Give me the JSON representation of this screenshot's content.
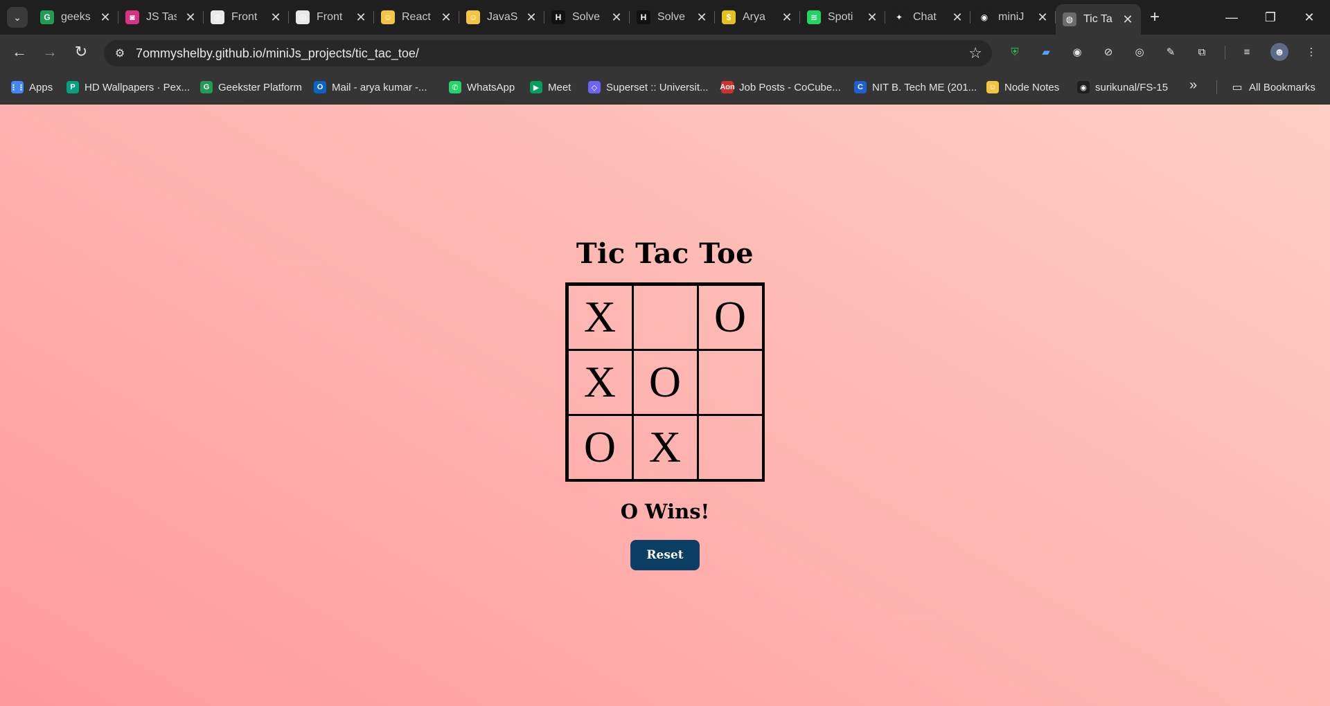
{
  "browser": {
    "tabs": [
      {
        "label": "geeks",
        "icon": "geekster-icon",
        "color": "#1f9d55",
        "glyph": "G"
      },
      {
        "label": "JS Tas",
        "icon": "task-app-icon",
        "color": "#d63384",
        "glyph": "◙"
      },
      {
        "label": "Front",
        "icon": "doc-icon",
        "color": "#e9e9e9",
        "glyph": "◎"
      },
      {
        "label": "Front",
        "icon": "doc-icon",
        "color": "#e9e9e9",
        "glyph": "◎"
      },
      {
        "label": "React",
        "icon": "smiley-icon",
        "color": "#f4c542",
        "glyph": "☺"
      },
      {
        "label": "JavaS",
        "icon": "smiley-icon",
        "color": "#f4c542",
        "glyph": "☺"
      },
      {
        "label": "Solve",
        "icon": "hackerrank-icon",
        "color": "#111111",
        "glyph": "H"
      },
      {
        "label": "Solve",
        "icon": "hackerrank-icon",
        "color": "#111111",
        "glyph": "H"
      },
      {
        "label": "Arya",
        "icon": "coin-icon",
        "color": "#e7c11a",
        "glyph": "$"
      },
      {
        "label": "Spoti",
        "icon": "spotify-icon",
        "color": "#1ed760",
        "glyph": "≋"
      },
      {
        "label": "Chat",
        "icon": "chatgpt-icon",
        "color": "#1f1f1f",
        "glyph": "✦"
      },
      {
        "label": "miniJ",
        "icon": "github-icon",
        "color": "#1f1f1f",
        "glyph": "◉"
      },
      {
        "label": "Tic Ta",
        "icon": "globe-icon",
        "color": "#6b6b6b",
        "glyph": "◍"
      }
    ],
    "new_tab": "+",
    "controls": {
      "minimize": "—",
      "restore": "❐",
      "close": "✕"
    },
    "url": "7ommyshelby.github.io/miniJs_projects/tic_tac_toe/",
    "bookmarks": [
      {
        "label": "Apps",
        "icon": "apps-grid-icon",
        "color": "#4285f4",
        "glyph": "⋮⋮"
      },
      {
        "label": "HD Wallpapers · Pex...",
        "icon": "pexels-icon",
        "color": "#05a081",
        "glyph": "P"
      },
      {
        "label": "Geekster Platform",
        "icon": "geekster-icon",
        "color": "#1f9d55",
        "glyph": "G"
      },
      {
        "label": "Mail - arya kumar -...",
        "icon": "outlook-icon",
        "color": "#0a64c8",
        "glyph": "O"
      },
      {
        "label": "WhatsApp",
        "icon": "whatsapp-icon",
        "color": "#25d366",
        "glyph": "✆"
      },
      {
        "label": "Meet",
        "icon": "meet-icon",
        "color": "#00a05a",
        "glyph": "▶"
      },
      {
        "label": "Superset :: Universit...",
        "icon": "superset-icon",
        "color": "#6c63ff",
        "glyph": "◇"
      },
      {
        "label": "Job Posts - CoCube...",
        "icon": "cocubes-icon",
        "color": "#d0312d",
        "glyph": "Aon"
      },
      {
        "label": "NIT B. Tech ME (201...",
        "icon": "c-logo-icon",
        "color": "#1d5fd6",
        "glyph": "C"
      },
      {
        "label": "Node Notes",
        "icon": "smiley-icon",
        "color": "#f4c542",
        "glyph": "☺"
      },
      {
        "label": "surikunal/FS-15",
        "icon": "github-icon",
        "color": "#1f1f1f",
        "glyph": "◉"
      }
    ],
    "all_bookmarks": "All Bookmarks"
  },
  "game": {
    "title": "Tic Tac Toe",
    "board": [
      "X",
      "",
      "O",
      "X",
      "O",
      "",
      "O",
      "X",
      ""
    ],
    "status": "O Wins!",
    "reset_label": "Reset"
  },
  "colors": {
    "gradient_start": "#ff9a9e",
    "gradient_end": "#fecfc3",
    "reset_button": "#0b3e63"
  }
}
